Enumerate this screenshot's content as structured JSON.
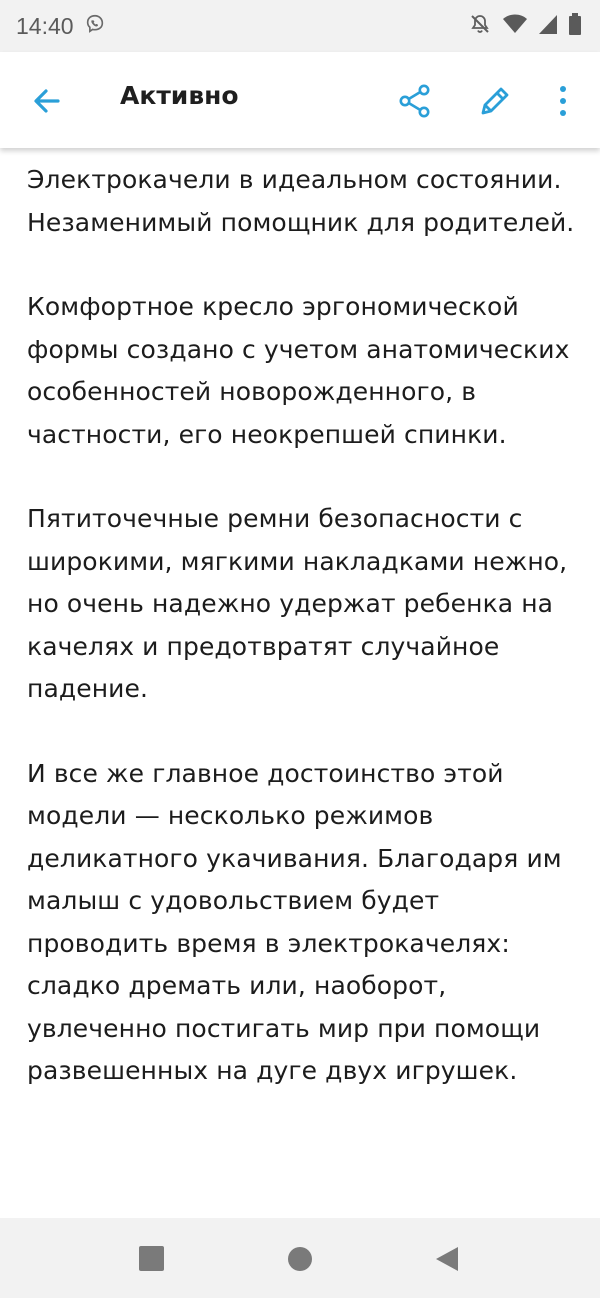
{
  "status_bar": {
    "time": "14:40",
    "icons": [
      "viber-icon",
      "notifications-off-icon",
      "wifi-icon",
      "signal-icon",
      "battery-icon"
    ]
  },
  "app_bar": {
    "title": "Активно",
    "icons": [
      "arrow-back-icon",
      "share-icon",
      "edit-pencil-icon",
      "more-vertical-icon"
    ],
    "accent_color": "#2a9fd8"
  },
  "content": {
    "paragraphs": [
      "Электрокачели в идеальном состоянии. Незаменимый помощник для родителей.",
      "Комфортное кресло эргономической формы создано с учетом анатомических особенностей новорожденного, в частности, его неокрепшей спинки.",
      "Пятиточечные ремни безопасности с широкими, мягкими накладками нежно, но очень надежно удержат ребенка на качелях и предотвратят случайное падение.",
      "И все же главное достоинство этой модели — несколько режимов деликатного укачивания. Благодаря им малыш с удовольствием будет проводить время в электрокачелях: сладко дремать или, наоборот, увлеченно постигать мир при помощи развешенных на дуге двух игрушек."
    ]
  },
  "nav_bar": {
    "icons": [
      "recents-square-icon",
      "home-circle-icon",
      "back-triangle-icon"
    ]
  }
}
